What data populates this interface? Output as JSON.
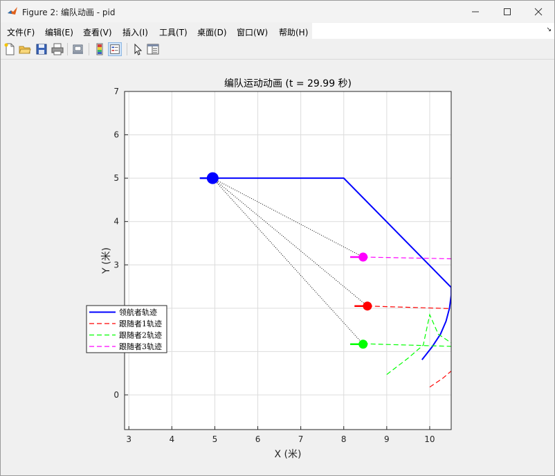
{
  "window": {
    "title": "Figure 2: 编队动画 - pid",
    "controls": [
      "minimize",
      "maximize",
      "close"
    ]
  },
  "menu": [
    {
      "label": "文件(F)"
    },
    {
      "label": "编辑(E)"
    },
    {
      "label": "查看(V)"
    },
    {
      "label": "插入(I)"
    },
    {
      "label": "工具(T)"
    },
    {
      "label": "桌面(D)"
    },
    {
      "label": "窗口(W)"
    },
    {
      "label": "帮助(H)"
    }
  ],
  "toolbar": {
    "icons": [
      "new-figure-icon",
      "open-file-icon",
      "save-icon",
      "print-icon",
      "print-preview-icon",
      "colorbar-icon",
      "legend-icon",
      "pointer-icon",
      "property-inspector-icon"
    ]
  },
  "chart_data": {
    "type": "line",
    "title": "编队运动动画 (t = 29.99 秒)",
    "xlabel": "X (米)",
    "ylabel": "Y (米)",
    "xlim": [
      2.9,
      10.5
    ],
    "ylim": [
      -0.8,
      7
    ],
    "xticks": [
      3,
      4,
      5,
      6,
      7,
      8,
      9,
      10
    ],
    "yticks": [
      0,
      1,
      2,
      3,
      4,
      5,
      6,
      7
    ],
    "ytick_labels": [
      "0",
      "",
      "",
      "3",
      "4",
      "5",
      "6",
      "7"
    ],
    "grid": true,
    "legend_position": "left",
    "series": [
      {
        "name": "领航者轨迹",
        "style": "solid",
        "color": "#0000ff",
        "points": [
          [
            4.95,
            5.0
          ],
          [
            8.0,
            5.0
          ],
          [
            10.5,
            2.48
          ],
          [
            10.5,
            2.3
          ],
          [
            10.46,
            2.0
          ],
          [
            10.38,
            1.7
          ],
          [
            10.25,
            1.4
          ],
          [
            10.05,
            1.1
          ],
          [
            9.82,
            0.81
          ]
        ]
      },
      {
        "name": "跟随者1轨迹",
        "style": "dashed",
        "color": "#ff0000",
        "points": [
          [
            8.55,
            2.05
          ],
          [
            10.5,
            1.99
          ]
        ]
      },
      {
        "name": "跟随者2轨迹",
        "style": "dashed",
        "color": "#00ff00",
        "points": [
          [
            8.45,
            1.18
          ],
          [
            10.5,
            1.12
          ]
        ]
      },
      {
        "name": "跟随者3轨迹",
        "style": "dashed",
        "color": "#ff00ff",
        "points": [
          [
            8.45,
            3.18
          ],
          [
            10.5,
            3.14
          ]
        ]
      }
    ],
    "extra_segments": [
      {
        "color": "#ff0000",
        "style": "dashed",
        "points": [
          [
            10.0,
            0.18
          ],
          [
            10.3,
            0.38
          ],
          [
            10.5,
            0.55
          ]
        ]
      },
      {
        "color": "#00ff00",
        "style": "dashed",
        "points": [
          [
            9.0,
            0.47
          ],
          [
            9.5,
            0.85
          ],
          [
            9.85,
            1.15
          ],
          [
            10.0,
            1.85
          ],
          [
            10.2,
            1.4
          ],
          [
            10.5,
            1.2
          ]
        ]
      }
    ],
    "agents": [
      {
        "name": "leader",
        "x": 4.95,
        "y": 5.0,
        "color": "#0000ff",
        "size": "large",
        "heading_tail_dx": -0.3
      },
      {
        "name": "follower1",
        "x": 8.55,
        "y": 2.05,
        "color": "#ff0000",
        "size": "small",
        "heading_tail_dx": -0.3
      },
      {
        "name": "follower2",
        "x": 8.45,
        "y": 1.17,
        "color": "#00ff00",
        "size": "small",
        "heading_tail_dx": -0.3
      },
      {
        "name": "follower3",
        "x": 8.45,
        "y": 3.18,
        "color": "#ff00ff",
        "size": "small",
        "heading_tail_dx": -0.3
      }
    ],
    "formation_links": [
      {
        "from": "leader",
        "to": "follower1"
      },
      {
        "from": "leader",
        "to": "follower2"
      },
      {
        "from": "leader",
        "to": "follower3"
      }
    ]
  }
}
